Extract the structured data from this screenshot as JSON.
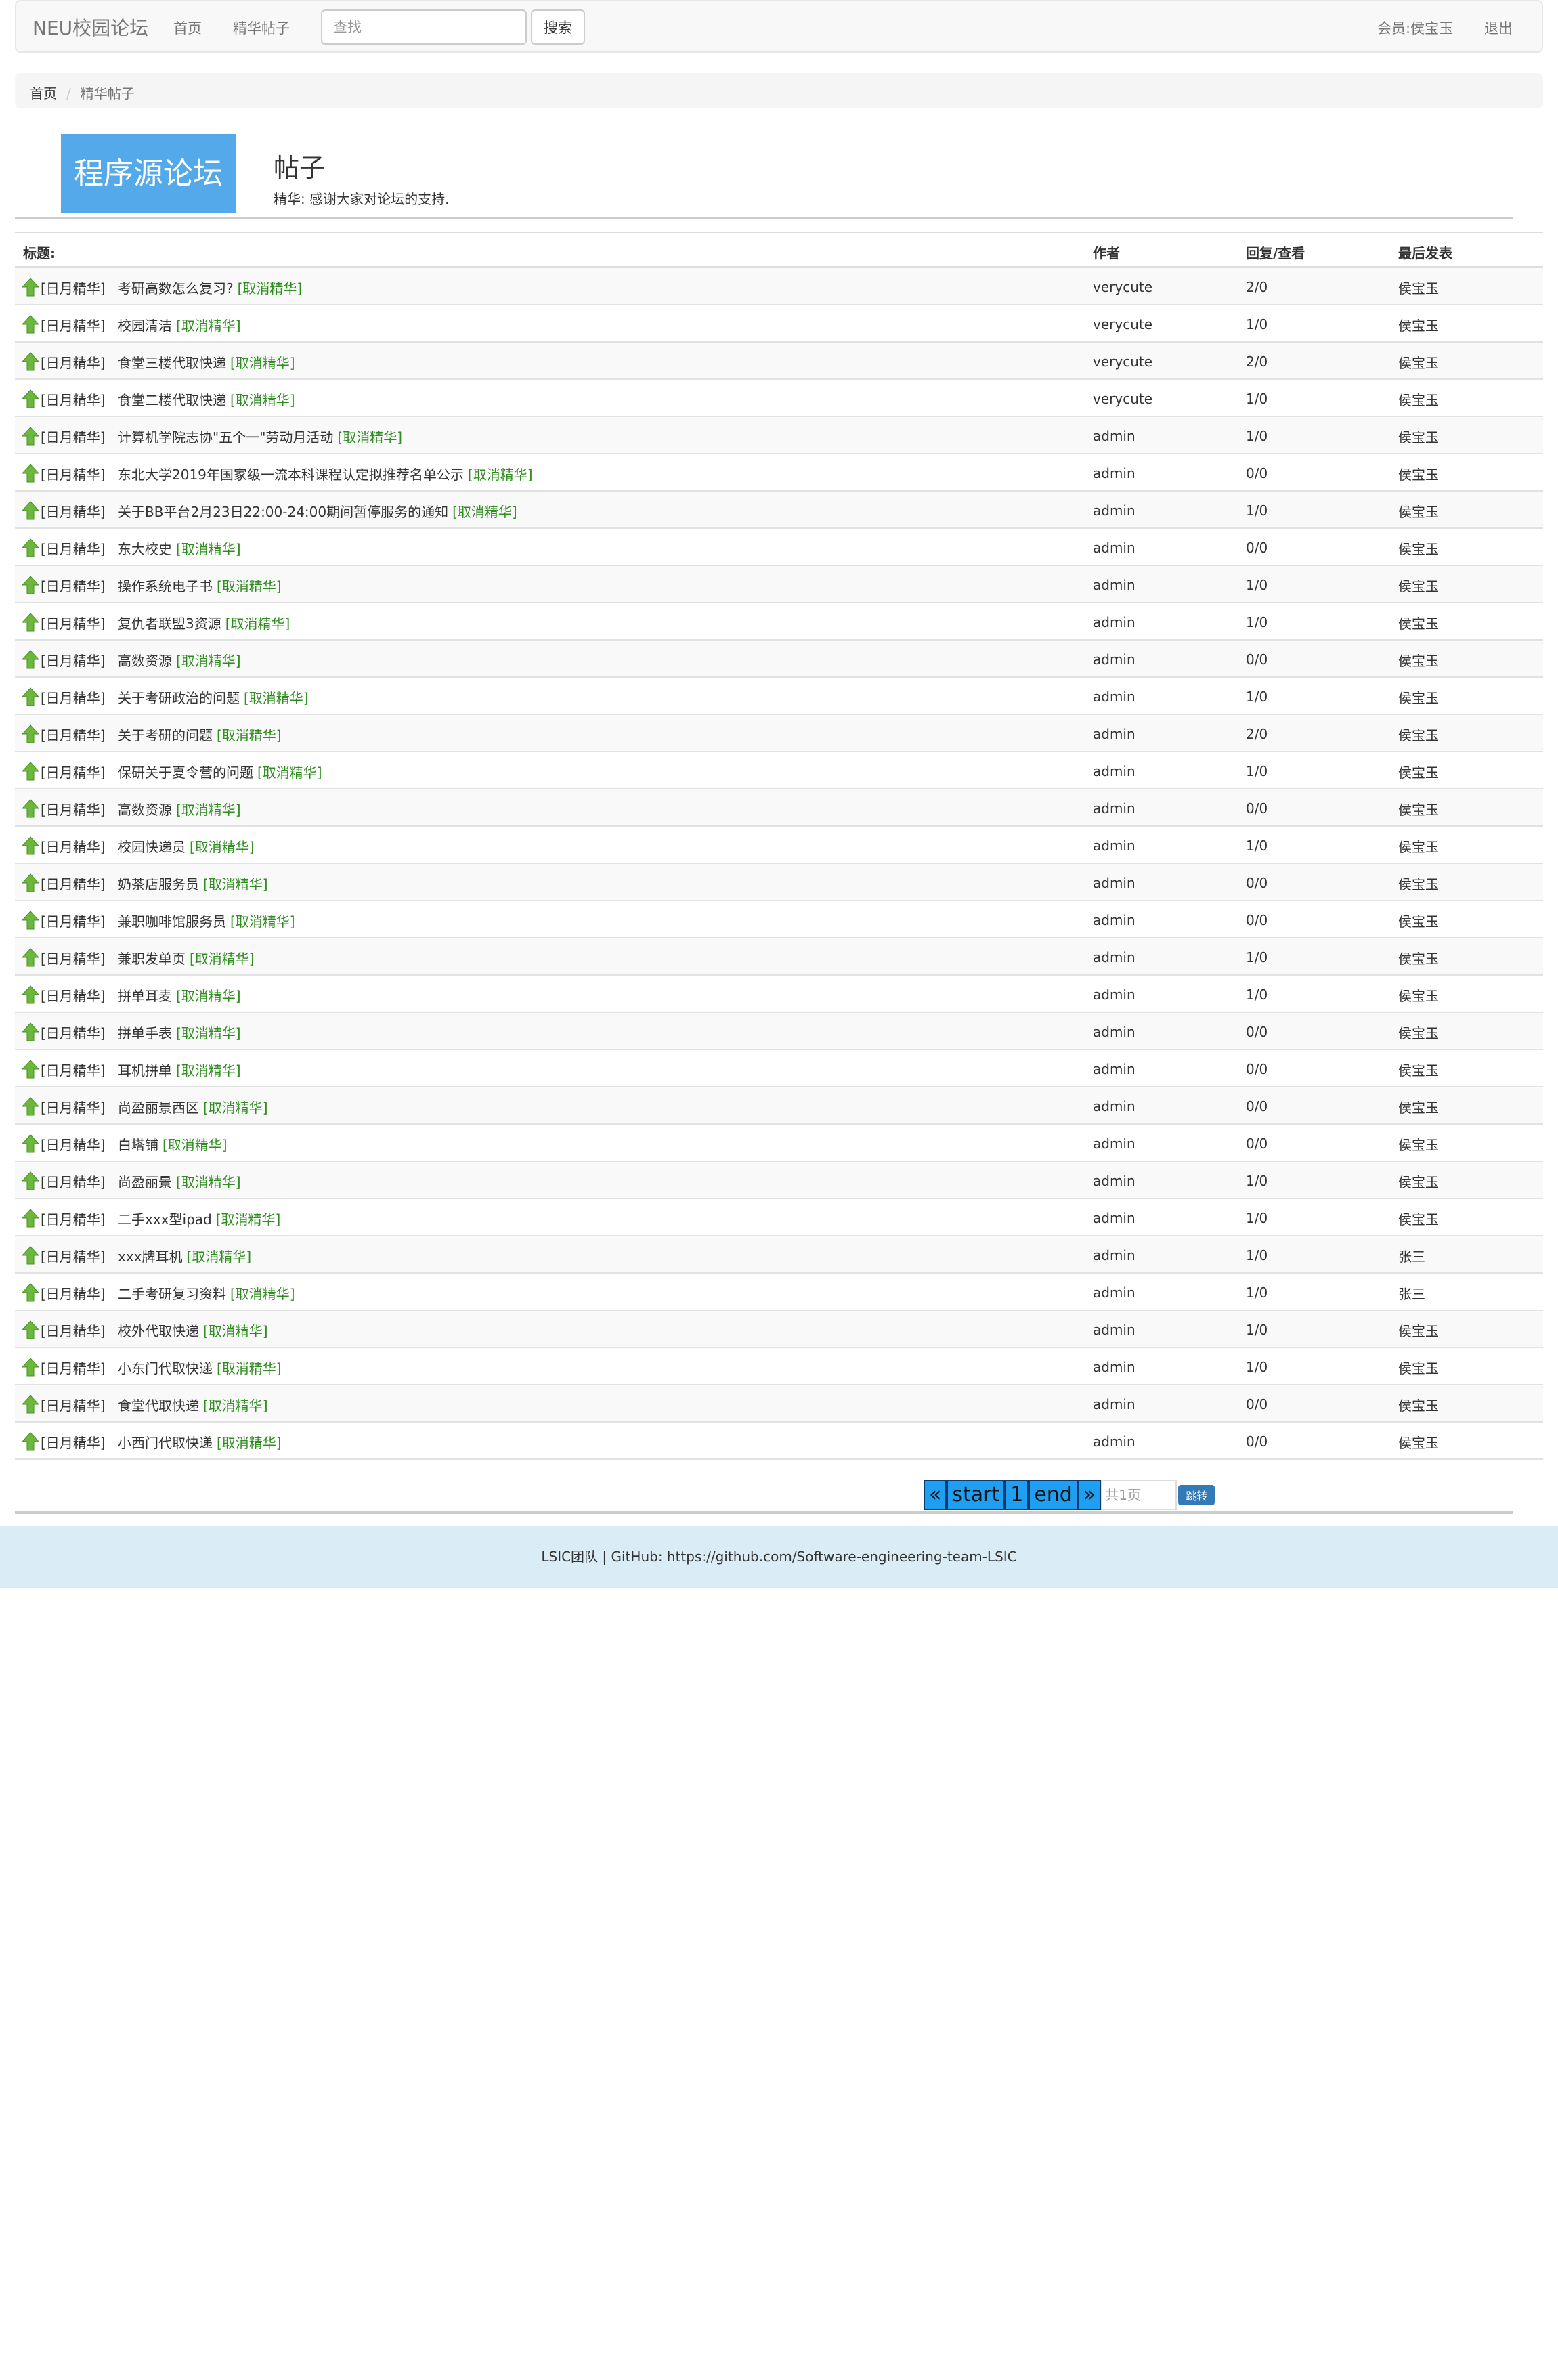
{
  "nav": {
    "brand": "NEU校园论坛",
    "home": "首页",
    "featured": "精华帖子",
    "search_placeholder": "查找",
    "search_button": "搜索",
    "member": "会员:侯宝玉",
    "logout": "退出"
  },
  "breadcrumb": {
    "home": "首页",
    "sep": "/",
    "current": "精华帖子"
  },
  "header": {
    "logo_text": "程序源论坛",
    "title": "帖子",
    "subtitle": "精华:   感谢大家对论坛的支持."
  },
  "table": {
    "headers": {
      "title": "标题:",
      "author": "作者",
      "reply": "回复/查看",
      "last": "最后发表"
    },
    "tag": "[日月精华]",
    "cancel_label": "[取消精华]",
    "rows": [
      {
        "title": "考研高数怎么复习?",
        "author": "verycute",
        "reply": "2/0",
        "last": "侯宝玉"
      },
      {
        "title": "校园清洁",
        "author": "verycute",
        "reply": "1/0",
        "last": "侯宝玉"
      },
      {
        "title": "食堂三楼代取快递",
        "author": "verycute",
        "reply": "2/0",
        "last": "侯宝玉"
      },
      {
        "title": "食堂二楼代取快递",
        "author": "verycute",
        "reply": "1/0",
        "last": "侯宝玉"
      },
      {
        "title": "计算机学院志协\"五个一\"劳动月活动",
        "author": "admin",
        "reply": "1/0",
        "last": "侯宝玉"
      },
      {
        "title": "东北大学2019年国家级一流本科课程认定拟推荐名单公示",
        "author": "admin",
        "reply": "0/0",
        "last": "侯宝玉"
      },
      {
        "title": "关于BB平台2月23日22:00-24:00期间暂停服务的通知",
        "author": "admin",
        "reply": "1/0",
        "last": "侯宝玉"
      },
      {
        "title": "东大校史",
        "author": "admin",
        "reply": "0/0",
        "last": "侯宝玉"
      },
      {
        "title": "操作系统电子书",
        "author": "admin",
        "reply": "1/0",
        "last": "侯宝玉"
      },
      {
        "title": "复仇者联盟3资源",
        "author": "admin",
        "reply": "1/0",
        "last": "侯宝玉"
      },
      {
        "title": "高数资源",
        "author": "admin",
        "reply": "0/0",
        "last": "侯宝玉"
      },
      {
        "title": "关于考研政治的问题",
        "author": "admin",
        "reply": "1/0",
        "last": "侯宝玉"
      },
      {
        "title": "关于考研的问题",
        "author": "admin",
        "reply": "2/0",
        "last": "侯宝玉"
      },
      {
        "title": "保研关于夏令营的问题",
        "author": "admin",
        "reply": "1/0",
        "last": "侯宝玉"
      },
      {
        "title": "高数资源",
        "author": "admin",
        "reply": "0/0",
        "last": "侯宝玉"
      },
      {
        "title": "校园快递员",
        "author": "admin",
        "reply": "1/0",
        "last": "侯宝玉"
      },
      {
        "title": "奶茶店服务员",
        "author": "admin",
        "reply": "0/0",
        "last": "侯宝玉"
      },
      {
        "title": "兼职咖啡馆服务员",
        "author": "admin",
        "reply": "0/0",
        "last": "侯宝玉"
      },
      {
        "title": "兼职发单页",
        "author": "admin",
        "reply": "1/0",
        "last": "侯宝玉"
      },
      {
        "title": "拼单耳麦",
        "author": "admin",
        "reply": "1/0",
        "last": "侯宝玉"
      },
      {
        "title": "拼单手表",
        "author": "admin",
        "reply": "0/0",
        "last": "侯宝玉"
      },
      {
        "title": "耳机拼单",
        "author": "admin",
        "reply": "0/0",
        "last": "侯宝玉"
      },
      {
        "title": "尚盈丽景西区",
        "author": "admin",
        "reply": "0/0",
        "last": "侯宝玉"
      },
      {
        "title": "白塔铺",
        "author": "admin",
        "reply": "0/0",
        "last": "侯宝玉"
      },
      {
        "title": "尚盈丽景",
        "author": "admin",
        "reply": "1/0",
        "last": "侯宝玉"
      },
      {
        "title": "二手xxx型ipad",
        "author": "admin",
        "reply": "1/0",
        "last": "侯宝玉"
      },
      {
        "title": "xxx牌耳机",
        "author": "admin",
        "reply": "1/0",
        "last": "张三"
      },
      {
        "title": "二手考研复习资料",
        "author": "admin",
        "reply": "1/0",
        "last": "张三"
      },
      {
        "title": "校外代取快递",
        "author": "admin",
        "reply": "1/0",
        "last": "侯宝玉"
      },
      {
        "title": "小东门代取快递",
        "author": "admin",
        "reply": "1/0",
        "last": "侯宝玉"
      },
      {
        "title": "食堂代取快递",
        "author": "admin",
        "reply": "0/0",
        "last": "侯宝玉"
      },
      {
        "title": "小西门代取快递",
        "author": "admin",
        "reply": "0/0",
        "last": "侯宝玉"
      }
    ]
  },
  "pagination": {
    "prev": "«",
    "start": "start",
    "page": "1",
    "end": "end",
    "next": "»",
    "input_placeholder": "共1页",
    "go_button": "跳转"
  },
  "footer": {
    "text": "LSIC团队 | GitHub:  https://github.com/Software-engineering-team-LSIC"
  },
  "colors": {
    "logo_bg": "#54a9ea",
    "cancel_link": "#2f8d1f",
    "pager_bg": "#1e9ff2",
    "footer_bg": "#daecf6",
    "arrow": "#6cb83c"
  }
}
